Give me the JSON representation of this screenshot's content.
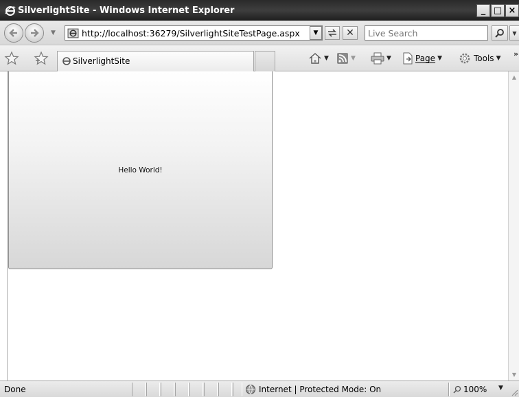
{
  "window": {
    "title": "SilverlightSite - Windows Internet Explorer",
    "minimize": "_",
    "maximize": "□",
    "close": "×"
  },
  "navigation": {
    "address": "http://localhost:36279/SilverlightSiteTestPage.aspx",
    "search_placeholder": "Live Search"
  },
  "tabs": [
    {
      "label": "SilverlightSite"
    }
  ],
  "command_bar": {
    "page_label": "Page",
    "tools_label": "Tools"
  },
  "content": {
    "silverlight_text": "Hello World!"
  },
  "status": {
    "text": "Done",
    "zone": "Internet | Protected Mode: On",
    "zoom": "100%"
  },
  "icons": [
    "ie-logo-icon",
    "back-arrow-icon",
    "forward-arrow-icon",
    "refresh-icon",
    "stop-icon",
    "search-icon",
    "favorites-star-icon",
    "add-favorites-icon",
    "home-icon",
    "rss-feed-icon",
    "print-icon",
    "page-icon",
    "tools-gear-icon",
    "globe-icon",
    "zoom-icon"
  ]
}
